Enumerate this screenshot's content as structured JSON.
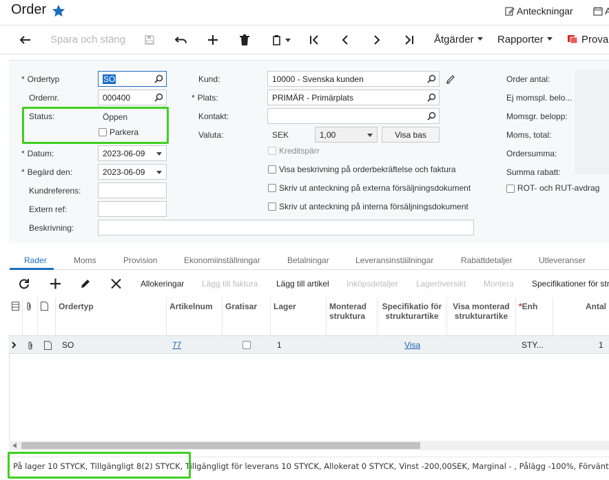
{
  "header": {
    "title": "Order",
    "notes_label": "Anteckningar",
    "calendar_label": "A"
  },
  "toolbar": {
    "save_close": "Spara och stäng",
    "actions": "Åtgärder",
    "reports": "Rapporter",
    "try_label": "Prova"
  },
  "form": {
    "order_type": {
      "label": "Ordertyp",
      "value": "SO"
    },
    "order_nr": {
      "label": "Ordernr.",
      "value": "000400"
    },
    "status": {
      "label": "Status:",
      "value": "Öppen"
    },
    "park": {
      "label": "Parkera",
      "checked": false
    },
    "date": {
      "label": "Datum:",
      "value": "2023-06-09"
    },
    "requested": {
      "label": "Begärd den:",
      "value": "2023-06-09"
    },
    "cust_ref": {
      "label": "Kundreferens:",
      "value": ""
    },
    "ext_ref": {
      "label": "Extern ref:",
      "value": ""
    },
    "desc": {
      "label": "Beskrivning:",
      "value": ""
    },
    "customer": {
      "label": "Kund:",
      "value": "10000 - Svenska kunden"
    },
    "place": {
      "label": "Plats:",
      "value": "PRIMÄR - Primärplats"
    },
    "contact": {
      "label": "Kontakt:",
      "value": ""
    },
    "currency": {
      "label": "Valuta:",
      "code": "SEK",
      "rate": "1,00",
      "base_button": "Visa bas"
    },
    "credit_block": {
      "label": "Kreditspärr"
    },
    "cb1": "Visa beskrivning på orderbekräftelse och faktura",
    "cb2": "Skriv ut anteckning på externa försäljningsdokument",
    "cb3": "Skriv ut anteckning på interna försäljningsdokument",
    "summary": [
      "Order antal:",
      "Ej momspl. belo...",
      "Momsgr. belopp:",
      "Moms, total:",
      "Ordersumma:",
      "Summa rabatt:"
    ],
    "rot_rut": "ROT- och RUT-avdrag"
  },
  "tabs": [
    "Rader",
    "Moms",
    "Provision",
    "Ekonomiinställningar",
    "Betalningar",
    "Leveransinställningar",
    "Rabattdetaljer",
    "Utleveranser"
  ],
  "grid_toolbar": {
    "allocations": "Allokeringar",
    "add_invoice": "Lägg till faktura",
    "add_item": "Lägg till artikel",
    "purchase_details": "Inköpsdetaljer",
    "stock_overview": "Lageröversikt",
    "assembly": "Montera",
    "spec": "Specifikationer för str"
  },
  "columns": [
    "Ordertyp",
    "Artikelnum",
    "Gratisar",
    "Lager",
    "Monterad struktura",
    "Specifikatio för strukturartike",
    "Visa monterad strukturartike",
    "Enh",
    "Antal"
  ],
  "row": {
    "order_type": "SO",
    "article": "77",
    "warehouse": "1",
    "spec_link": "Visa",
    "unit": "STY...",
    "qty": "1"
  },
  "status_bar": "På lager 10 STYCK, Tillgängligt 8(2) STYCK, Tillgängligt för leverans 10 STYCK, Allokerat 0 STYCK, Vinst -200,00SEK, Marginal - , Pålägg -100%, Förvänt",
  "colors": {
    "accent": "#1b6dc1",
    "highlight": "#3ecf1f",
    "red": "#d62b2b"
  }
}
